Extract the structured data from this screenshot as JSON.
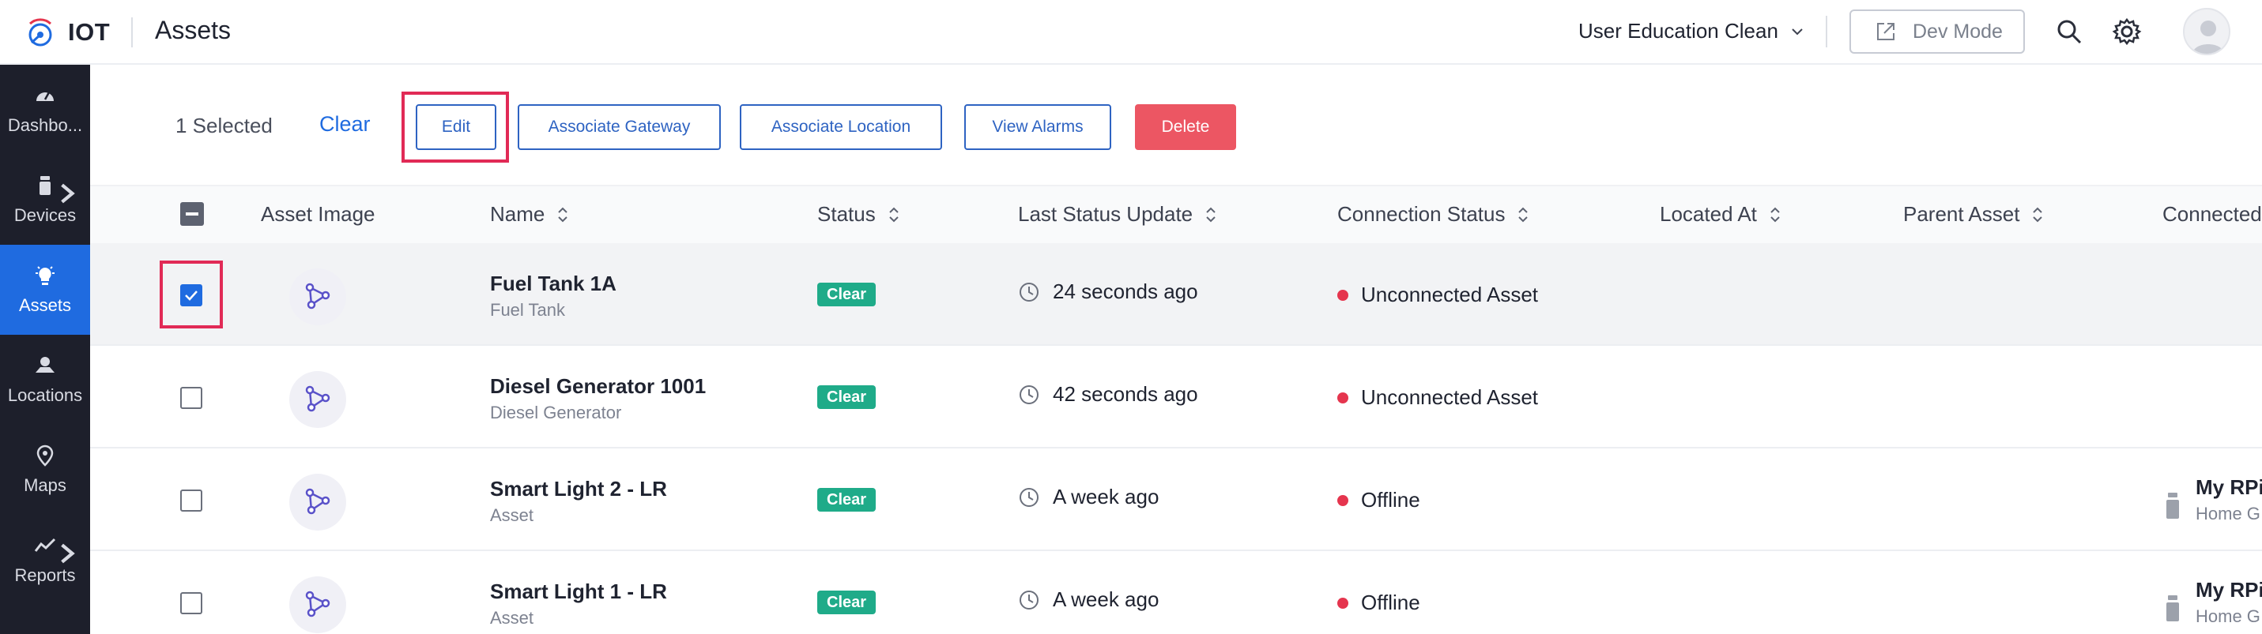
{
  "app": {
    "logo_text": "IOT",
    "page_title": "Assets",
    "account_name": "User Education Clean",
    "dev_mode_label": "Dev Mode"
  },
  "sidebar": {
    "items": [
      {
        "label": "Dashbo...",
        "icon": "dashboard-icon",
        "active": false
      },
      {
        "label": "Devices",
        "icon": "devices-icon",
        "active": false,
        "has_submenu": true
      },
      {
        "label": "Assets",
        "icon": "bulb-icon",
        "active": true
      },
      {
        "label": "Locations",
        "icon": "location-icon",
        "active": false
      },
      {
        "label": "Maps",
        "icon": "map-pin-icon",
        "active": false
      },
      {
        "label": "Reports",
        "icon": "reports-icon",
        "active": false,
        "has_submenu": true
      }
    ]
  },
  "actionbar": {
    "selected_text": "1 Selected",
    "clear_label": "Clear",
    "edit_label": "Edit",
    "associate_gateway_label": "Associate Gateway",
    "associate_location_label": "Associate Location",
    "view_alarms_label": "View Alarms",
    "delete_label": "Delete"
  },
  "table": {
    "columns": [
      "Asset Image",
      "Name",
      "Status",
      "Last Status Update",
      "Connection Status",
      "Located At",
      "Parent Asset",
      "Connected"
    ],
    "rows": [
      {
        "name": "Fuel Tank 1A",
        "type": "Fuel Tank",
        "status": "Clear",
        "last_update": "24 seconds ago",
        "connection": "Unconnected Asset",
        "selected": true,
        "connected_name": "",
        "connected_sub": ""
      },
      {
        "name": "Diesel Generator 1001",
        "type": "Diesel Generator",
        "status": "Clear",
        "last_update": "42 seconds ago",
        "connection": "Unconnected Asset",
        "selected": false,
        "connected_name": "",
        "connected_sub": ""
      },
      {
        "name": "Smart Light 2 - LR",
        "type": "Asset",
        "status": "Clear",
        "last_update": "A week ago",
        "connection": "Offline",
        "selected": false,
        "connected_name": "My RPi",
        "connected_sub": "Home G"
      },
      {
        "name": "Smart Light 1 - LR",
        "type": "Asset",
        "status": "Clear",
        "last_update": "A week ago",
        "connection": "Offline",
        "selected": false,
        "connected_name": "My RPi",
        "connected_sub": "Home G"
      }
    ]
  },
  "colors": {
    "primary": "#1f6be0",
    "sidebar_bg": "#1d1f2b",
    "status_clear": "#1fab89",
    "offline_dot": "#e5354e",
    "delete": "#ec5663",
    "highlight": "#e12a56"
  }
}
